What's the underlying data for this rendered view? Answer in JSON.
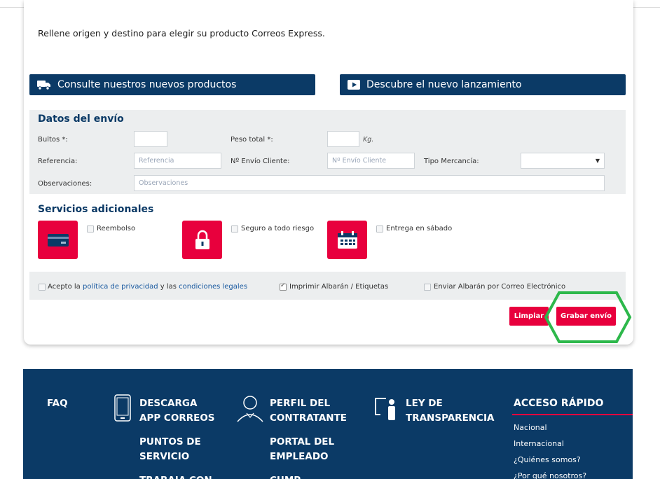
{
  "intro": "Rellene origen y destino para elegir su producto Correos Express.",
  "banners": {
    "products": "Consulte nuestros nuevos productos",
    "launch": "Descubre el nuevo lanzamiento"
  },
  "shipment": {
    "title": "Datos del envío",
    "bultos_label": "Bultos *:",
    "bultos_value": "",
    "peso_label": "Peso total *:",
    "peso_value": "",
    "peso_unit": "Kg.",
    "referencia_label": "Referencia:",
    "referencia_placeholder": "Referencia",
    "envio_cliente_label": "Nº Envío Cliente:",
    "envio_cliente_placeholder": "Nº Envío Cliente",
    "tipo_label": "Tipo Mercancía:",
    "tipo_value": "",
    "observaciones_label": "Observaciones:",
    "observaciones_placeholder": "Observaciones"
  },
  "services": {
    "title": "Servicios adicionales",
    "items": [
      {
        "label": "Reembolso",
        "checked": false,
        "icon": "credit-card-icon"
      },
      {
        "label": "Seguro a todo riesgo",
        "checked": false,
        "icon": "padlock-icon"
      },
      {
        "label": "Entrega en sábado",
        "checked": false,
        "icon": "calendar-icon"
      }
    ]
  },
  "consent": {
    "accept_prefix": "Acepto la ",
    "privacy_link": "política de privacidad",
    "accept_middle": " y las ",
    "conditions_link": "condiciones legales",
    "print_label": "Imprimir Albarán / Etiquetas",
    "print_checked": true,
    "email_label": "Enviar Albarán por Correo Electrónico",
    "email_checked": false
  },
  "actions": {
    "clear": "Limpiar",
    "save": "Grabar envío",
    "highlight_color": "#2db84b"
  },
  "footer": {
    "faq": "FAQ",
    "app_line1": "DESCARGA",
    "app_line2": "APP CORREOS",
    "puntos_line1": "PUNTOS DE",
    "puntos_line2": "SERVICIO",
    "trabaja": "TRABAJA CON",
    "perfil_line1": "PERFIL DEL",
    "perfil_line2": "CONTRATANTE",
    "portal_line1": "PORTAL DEL",
    "portal_line2": "EMPLEADO",
    "cump": "CUMP",
    "ley_line1": "LEY DE",
    "ley_line2": "TRANSPARENCIA",
    "quick_title": "ACCESO RÁPIDO",
    "quick_links": [
      "Nacional",
      "Internacional",
      "¿Quiénes somos?",
      "¿Por qué nosotros?"
    ]
  },
  "colors": {
    "brand_blue": "#0b3a66",
    "brand_red": "#e8003d",
    "panel_gray": "#eceeef"
  }
}
